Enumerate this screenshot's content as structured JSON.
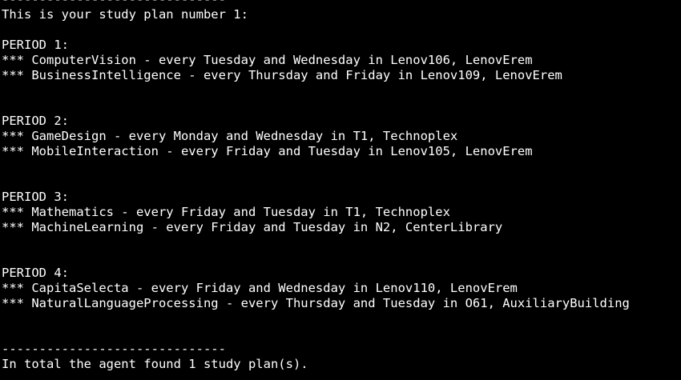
{
  "colors": {
    "background": "#000000",
    "foreground": "#ffffff"
  },
  "terminal": {
    "separator_top": "------------------------------",
    "plan_heading": "This is your study plan number 1:",
    "periods": [
      {
        "heading": "PERIOD 1:",
        "courses": [
          "*** ComputerVision - every Tuesday and Wednesday in Lenov106, LenovErem",
          "*** BusinessIntelligence - every Thursday and Friday in Lenov109, LenovErem"
        ]
      },
      {
        "heading": "PERIOD 2:",
        "courses": [
          "*** GameDesign - every Monday and Wednesday in T1, Technoplex",
          "*** MobileInteraction - every Friday and Tuesday in Lenov105, LenovErem"
        ]
      },
      {
        "heading": "PERIOD 3:",
        "courses": [
          "*** Mathematics - every Friday and Tuesday in T1, Technoplex",
          "*** MachineLearning - every Friday and Tuesday in N2, CenterLibrary"
        ]
      },
      {
        "heading": "PERIOD 4:",
        "courses": [
          "*** CapitaSelecta - every Friday and Wednesday in Lenov110, LenovErem",
          "*** NaturalLanguageProcessing - every Thursday and Tuesday in O61, AuxiliaryBuilding"
        ]
      }
    ],
    "separator_bottom": "------------------------------",
    "summary": "In total the agent found 1 study plan(s)."
  }
}
